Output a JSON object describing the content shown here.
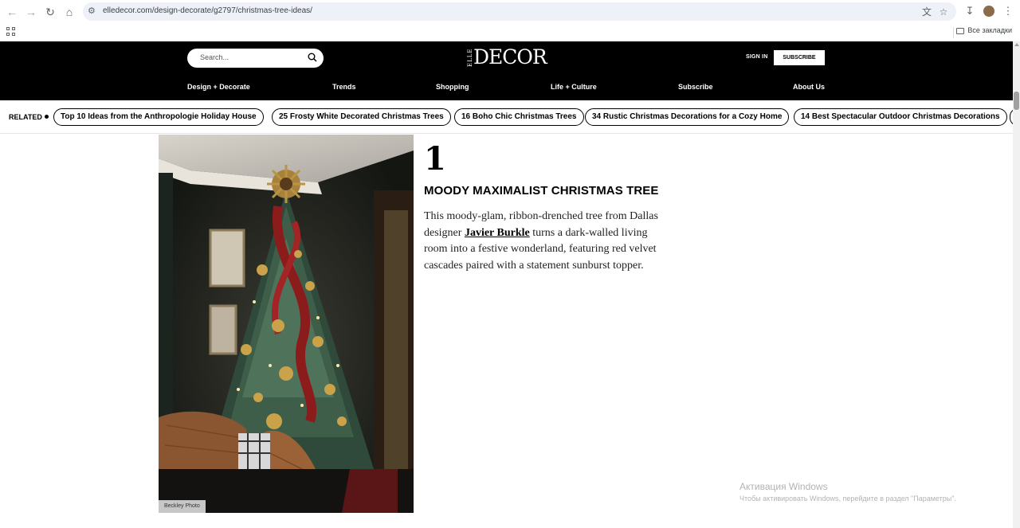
{
  "browser": {
    "url": "elledecor.com/design-decorate/g2797/christmas-tree-ideas/",
    "bookmarks_all_label": "Все закладки"
  },
  "header": {
    "search_placeholder": "Search...",
    "logo_elle": "ELLE",
    "logo_decor": "DECOR",
    "sign_in": "SIGN IN",
    "subscribe": "SUBSCRIBE"
  },
  "nav": {
    "items": [
      "Design + Decorate",
      "Trends",
      "Shopping",
      "Life + Culture",
      "Subscribe",
      "About Us"
    ]
  },
  "related": {
    "label": "RELATED",
    "items": [
      "Top 10 Ideas from the Anthropologie Holiday House",
      "25 Frosty White Decorated Christmas Trees",
      "16 Boho Chic Christmas Trees",
      "34 Rustic Christmas Decorations for a Cozy Home",
      "14 Best Spectacular Outdoor Christmas Decorations"
    ]
  },
  "slide": {
    "number": "1",
    "title": "MOODY MAXIMALIST CHRISTMAS TREE",
    "body_before": "This moody-glam, ribbon-drenched tree from Dallas designer ",
    "link_text": "Javier Burkle",
    "body_after": " turns a dark-walled living room into a festive wonderland, featuring red velvet cascades paired with a statement sunburst topper.",
    "photo_credit": "Beckley Photo"
  },
  "watermark": {
    "line1": "Активация Windows",
    "line2": "Чтобы активировать Windows, перейдите в раздел \"Параметры\"."
  },
  "colors": {
    "header_bg": "#000000",
    "accent": "#ffffff",
    "ribbon_red": "#8c1c1c"
  }
}
